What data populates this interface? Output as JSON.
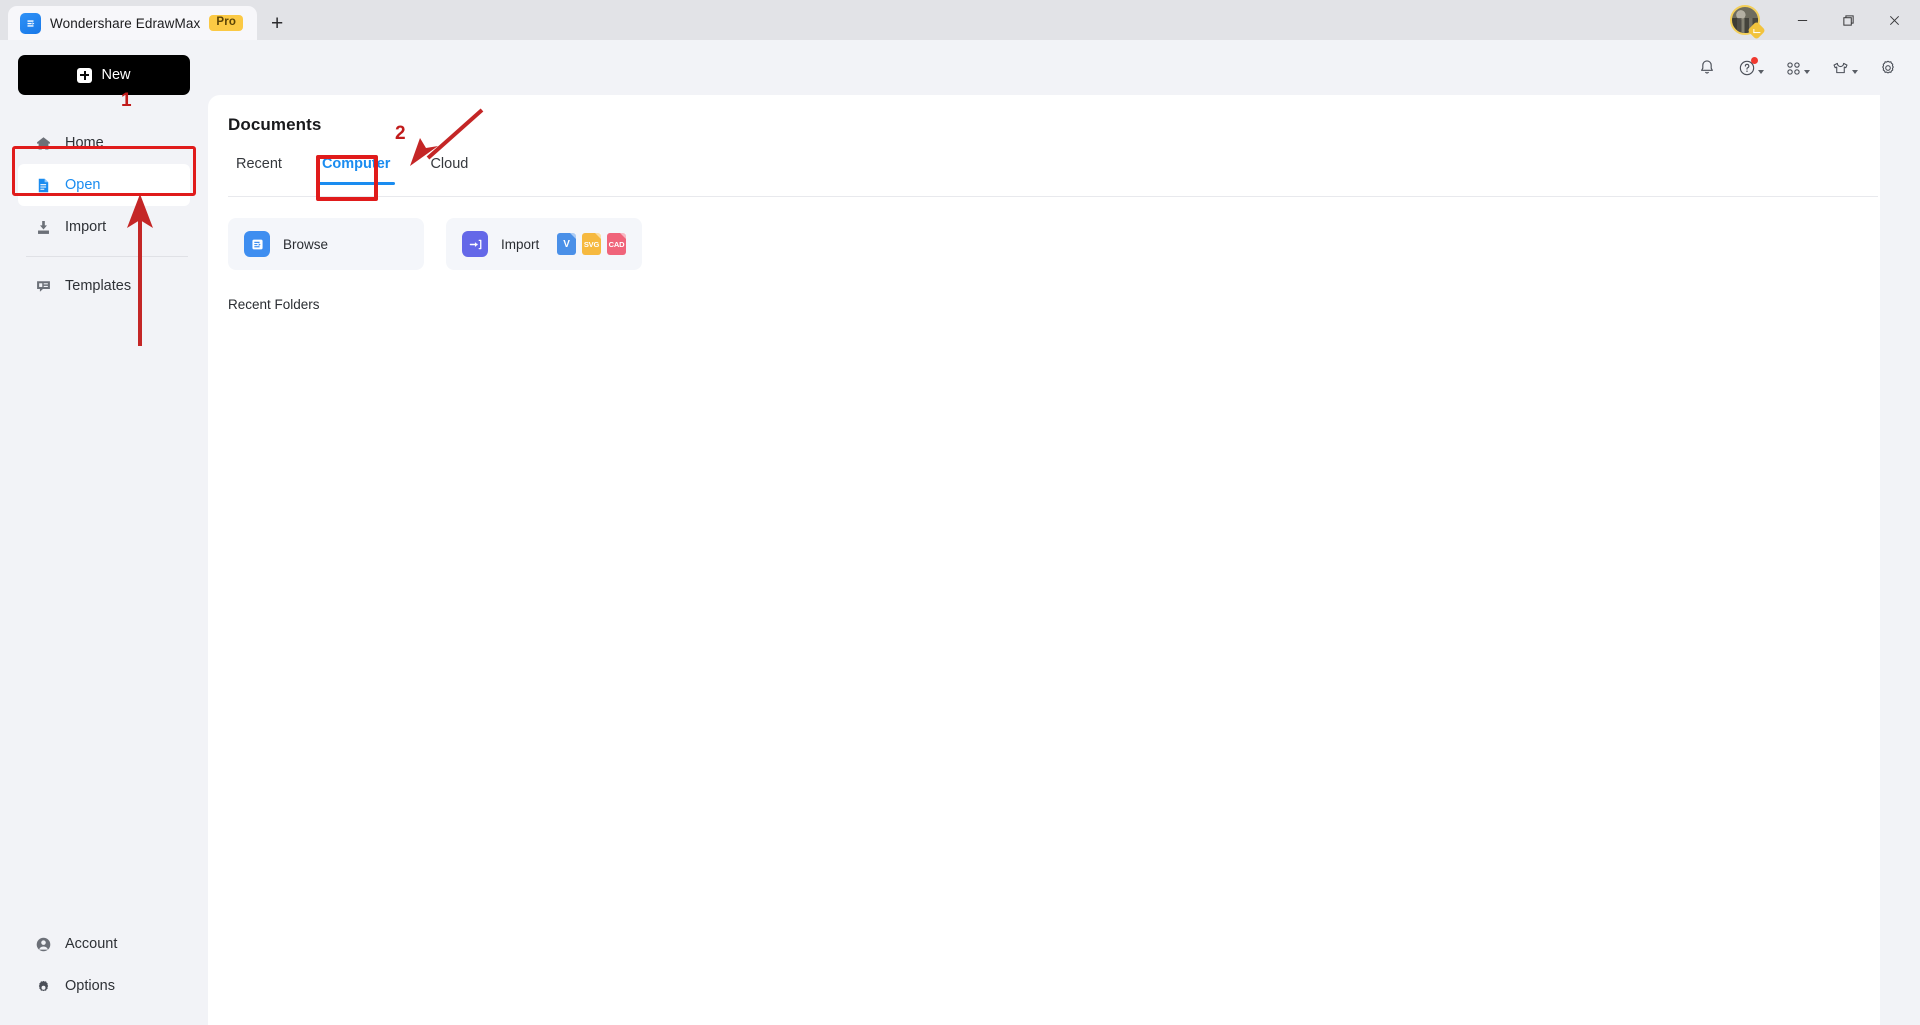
{
  "window": {
    "tab_title": "Wondershare EdrawMax",
    "pro_badge": "Pro",
    "new_tab_icon": "plus-icon",
    "minimize_icon": "minimize-icon",
    "maximize_icon": "maximize-icon",
    "close_icon": "close-icon",
    "avatar_icon": "user-avatar"
  },
  "toolbar": {
    "items": [
      {
        "name": "notifications",
        "icon": "bell-icon",
        "has_caret": false,
        "has_badge": false
      },
      {
        "name": "help",
        "icon": "question-circle-icon",
        "has_caret": true,
        "has_badge": true
      },
      {
        "name": "apps",
        "icon": "grid-apps-icon",
        "has_caret": true,
        "has_badge": false
      },
      {
        "name": "theme",
        "icon": "shirt-icon",
        "has_caret": true,
        "has_badge": false
      },
      {
        "name": "settings",
        "icon": "gear-icon",
        "has_caret": false,
        "has_badge": false
      }
    ]
  },
  "sidebar": {
    "new_button": "New",
    "new_button_icon": "plus-square-icon",
    "items": [
      {
        "label": "Home",
        "icon": "home-icon",
        "active": false
      },
      {
        "label": "Open",
        "icon": "document-icon",
        "active": true
      },
      {
        "label": "Import",
        "icon": "import-icon",
        "active": false
      },
      {
        "label": "Templates",
        "icon": "templates-icon",
        "active": false
      }
    ],
    "bottom_items": [
      {
        "label": "Account",
        "icon": "account-icon"
      },
      {
        "label": "Options",
        "icon": "options-gear-icon"
      }
    ]
  },
  "main": {
    "title": "Documents",
    "tabs": [
      {
        "label": "Recent",
        "active": false
      },
      {
        "label": "Computer",
        "active": true
      },
      {
        "label": "Cloud",
        "active": false
      }
    ],
    "cards": [
      {
        "label": "Browse",
        "icon": "edraw-file-icon",
        "badges": []
      },
      {
        "label": "Import",
        "icon": "import-arrow-icon",
        "badges": [
          {
            "text": "V",
            "color": "#4a90e8"
          },
          {
            "text": "SVG",
            "color": "#f6b93f"
          },
          {
            "text": "CAD",
            "color": "#f0647a"
          }
        ]
      }
    ],
    "recent_folders_label": "Recent Folders"
  },
  "annotations": [
    {
      "number": "1",
      "target": "sidebar-item-open",
      "shape": "box-and-arrow"
    },
    {
      "number": "2",
      "target": "tab-computer",
      "shape": "box-and-arrow"
    }
  ],
  "colors": {
    "accent": "#1a8cf0",
    "annotation": "#e01b1b",
    "pro_badge": "#fbc944",
    "sidebar_bg": "#f2f3f7",
    "panel_bg": "#ffffff"
  }
}
